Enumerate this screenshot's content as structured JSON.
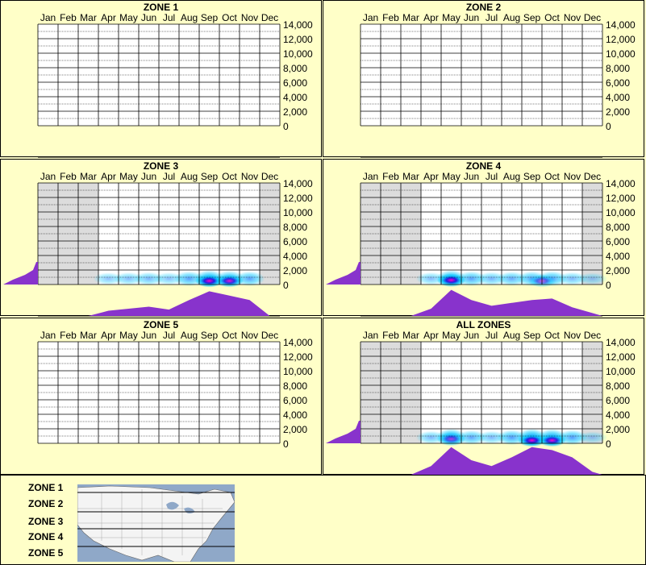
{
  "months": [
    "Jan",
    "Feb",
    "Mar",
    "Apr",
    "May",
    "Jun",
    "Jul",
    "Aug",
    "Sep",
    "Oct",
    "Nov",
    "Dec"
  ],
  "y_ticks": [
    "14,000",
    "12,000",
    "10,000",
    "8,000",
    "6,000",
    "4,000",
    "2,000",
    "0"
  ],
  "chart_data": [
    {
      "type": "heatmap",
      "title": "ZONE 1",
      "ylim": [
        0,
        14000
      ],
      "has_data": false,
      "monthly_activity": [
        0,
        0,
        0,
        0,
        0,
        0,
        0,
        0,
        0,
        0,
        0,
        0
      ],
      "elevation_profile": []
    },
    {
      "type": "heatmap",
      "title": "ZONE 2",
      "ylim": [
        0,
        14000
      ],
      "has_data": false,
      "monthly_activity": [
        0,
        0,
        0,
        0,
        0,
        0,
        0,
        0,
        0,
        0,
        0,
        0
      ],
      "elevation_profile": []
    },
    {
      "type": "heatmap",
      "title": "ZONE 3",
      "ylim": [
        0,
        14000
      ],
      "has_data": true,
      "monthly_activity": [
        0,
        0,
        0,
        0.18,
        0.25,
        0.32,
        0.22,
        0.55,
        0.85,
        0.7,
        0.55,
        0
      ],
      "elevation_profile": [
        0.05,
        0.1,
        0.2,
        0.4,
        0.85
      ],
      "hotspots": [
        {
          "month": 8.5,
          "elev": 500,
          "intensity": 1.0
        },
        {
          "month": 9.5,
          "elev": 500,
          "intensity": 0.9
        }
      ],
      "grey_months": [
        0,
        1,
        2,
        11
      ]
    },
    {
      "type": "heatmap",
      "title": "ZONE 4",
      "ylim": [
        0,
        14000
      ],
      "has_data": true,
      "monthly_activity": [
        0,
        0,
        0,
        0.25,
        0.9,
        0.55,
        0.35,
        0.45,
        0.55,
        0.6,
        0.3,
        0.1
      ],
      "elevation_profile": [
        0.05,
        0.1,
        0.25,
        0.45,
        0.9
      ],
      "hotspots": [
        {
          "month": 4.5,
          "elev": 600,
          "intensity": 1.0
        },
        {
          "month": 9.0,
          "elev": 500,
          "intensity": 0.6
        }
      ],
      "grey_months": [
        0,
        1,
        2,
        11
      ]
    },
    {
      "type": "heatmap",
      "title": "ZONE 5",
      "ylim": [
        0,
        14000
      ],
      "has_data": false,
      "monthly_activity": [
        0,
        0,
        0,
        0,
        0,
        0,
        0,
        0,
        0,
        0,
        0,
        0
      ],
      "elevation_profile": []
    },
    {
      "type": "heatmap",
      "title": "ALL ZONES",
      "ylim": [
        0,
        14000
      ],
      "has_data": true,
      "monthly_activity": [
        0,
        0,
        0,
        0.3,
        0.95,
        0.5,
        0.3,
        0.6,
        0.95,
        0.85,
        0.6,
        0.1
      ],
      "elevation_profile": [
        0.05,
        0.1,
        0.25,
        0.45,
        0.9
      ],
      "hotspots": [
        {
          "month": 4.5,
          "elev": 600,
          "intensity": 0.6
        },
        {
          "month": 8.5,
          "elev": 400,
          "intensity": 1.0
        },
        {
          "month": 9.5,
          "elev": 400,
          "intensity": 0.95
        }
      ],
      "grey_months": [
        0,
        1,
        2,
        11
      ]
    }
  ],
  "legend": {
    "zones": [
      "ZONE 1",
      "ZONE 2",
      "ZONE 3",
      "ZONE 4",
      "ZONE 5"
    ]
  },
  "colors": {
    "background": "#ffffc8",
    "profile": "#8833cc",
    "grey": "#dcdcdc",
    "heat_low": "#00c8ff",
    "heat_high": "#ff00cc"
  }
}
